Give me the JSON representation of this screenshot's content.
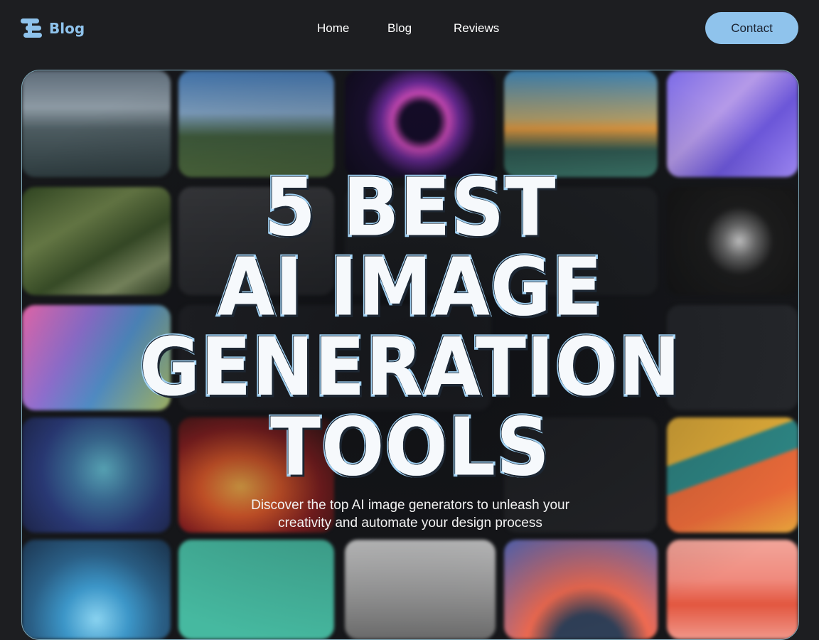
{
  "nav": {
    "logo_icon": "stacked-bars-logo-icon",
    "logo_text": "Blog",
    "links": [
      "Home",
      "Blog",
      "Reviews"
    ],
    "contact_label": "Contact"
  },
  "hero": {
    "headline_lines": [
      "5 BEST",
      "AI IMAGE",
      "GENERATION",
      "TOOLS"
    ],
    "subtitle_lines": [
      "Discover the top AI image generators to unleash your",
      "creativity and automate your design process"
    ]
  },
  "colors": {
    "background": "#1d1e21",
    "accent": "#8fc3ec",
    "headline_fill": "#f6f9fc",
    "headline_outline": "#9fd0f2"
  }
}
